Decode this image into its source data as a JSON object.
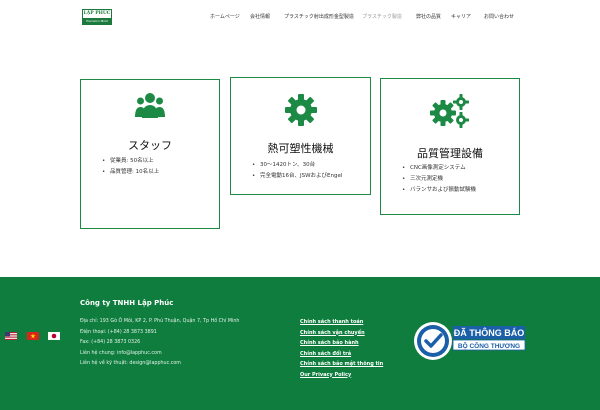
{
  "header": {
    "logo_title": "LẬP PHÚC",
    "logo_sub": "Precision Mold",
    "nav": [
      {
        "label": "ホームページ",
        "active": false
      },
      {
        "label": "会社情報",
        "active": false
      },
      {
        "label": "プラスチック射出成形金型製造",
        "active": false
      },
      {
        "label": "プラスチック製造",
        "active": true
      },
      {
        "label": "弊社の品質",
        "active": false
      },
      {
        "label": "キャリア",
        "active": false
      },
      {
        "label": "お問い合わせ",
        "active": false
      }
    ]
  },
  "cards": [
    {
      "title": "スタッフ",
      "icon": "users-icon",
      "items": [
        "従業員: 50名以上",
        "品質管理: 10名以上"
      ]
    },
    {
      "title": "熱可塑性機械",
      "icon": "gear-icon",
      "items": [
        "30〜1420トン、30台",
        "完全電動16台、JSWおよびEngel"
      ]
    },
    {
      "title": "品質管理設備",
      "icon": "gears-icon",
      "items": [
        "CNC画像測定システム",
        "三次元測定機",
        "バランサおよび振動試験機"
      ]
    }
  ],
  "footer": {
    "company": "Công ty TNHH Lập Phúc",
    "info": [
      "Địa chỉ: 193 Gò Ô Môi, KP 2, P. Phú Thuận, Quận 7, Tp Hồ Chí Minh",
      "Điện thoại: (+84) 28 3873 3891",
      "Fax: (+84) 28 3873 0326",
      "Liên hệ chung: info@lapphuc.com",
      "Liên hệ về kỹ thuật: design@lapphuc.com"
    ],
    "links": [
      "Chính sách thanh toán",
      "Chính sách vận chuyển",
      "Chính sách bảo hành",
      "Chính sách đổi trả",
      "Chính sách bảo mật thông tin",
      "Our Privacy Policy"
    ],
    "badge_line1": "ĐÃ THÔNG BÁO",
    "badge_line2": "BỘ CÔNG THƯƠNG",
    "flags": [
      "us-flag-icon",
      "vn-flag-icon",
      "jp-flag-icon"
    ]
  },
  "colors": {
    "brand": "#0f7d3e",
    "card_border": "#1c8a44",
    "icon": "#1c8a44",
    "badge_blue": "#1b5fa8"
  }
}
